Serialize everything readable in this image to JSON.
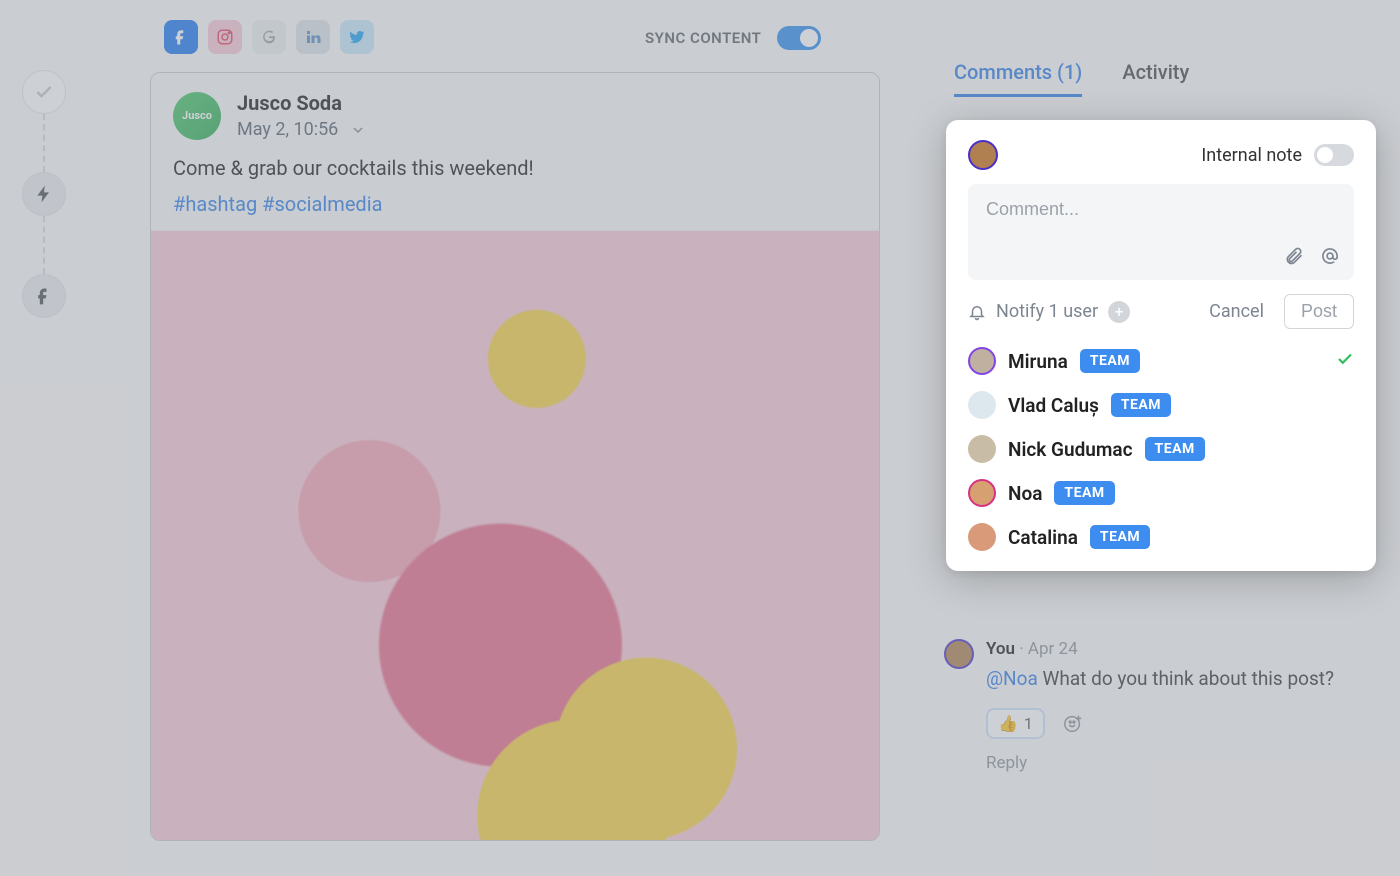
{
  "timeline": {
    "step1_icon": "check",
    "step2_icon": "bolt",
    "step3_icon": "facebook"
  },
  "platforms": {
    "facebook": "facebook-icon",
    "instagram": "instagram-icon",
    "google": "google-icon",
    "linkedin": "linkedin-icon",
    "twitter": "twitter-icon"
  },
  "sync": {
    "label": "SYNC CONTENT",
    "on": true
  },
  "post": {
    "author_name": "Jusco Soda",
    "author_short": "Jusco",
    "date": "May 2, 10:56",
    "body": "Come & grab our cocktails this weekend!",
    "hashtags": "#hashtag #socialmedia"
  },
  "tabs": {
    "comments_label": "Comments (1)",
    "activity_label": "Activity",
    "active": "comments"
  },
  "panel": {
    "internal_note_label": "Internal note",
    "internal_note_on": false,
    "comment_placeholder": "Comment...",
    "notify_text": "Notify 1 user",
    "cancel_label": "Cancel",
    "post_label": "Post",
    "team_badge": "TEAM",
    "users": [
      {
        "name": "Miruna",
        "badge": true,
        "checked": true,
        "ring": "purple"
      },
      {
        "name": "Vlad Caluș",
        "badge": true,
        "checked": false,
        "ring": ""
      },
      {
        "name": "Nick Gudumac",
        "badge": true,
        "checked": false,
        "ring": ""
      },
      {
        "name": "Noa",
        "badge": true,
        "checked": false,
        "ring": "pink"
      },
      {
        "name": "Catalina",
        "badge": true,
        "checked": false,
        "ring": ""
      }
    ]
  },
  "existing_comment": {
    "author": "You",
    "date": "Apr 24",
    "mention": "@Noa",
    "text": "What do you think about this post?",
    "reaction_emoji": "👍",
    "reaction_count": "1",
    "reply_label": "Reply"
  }
}
